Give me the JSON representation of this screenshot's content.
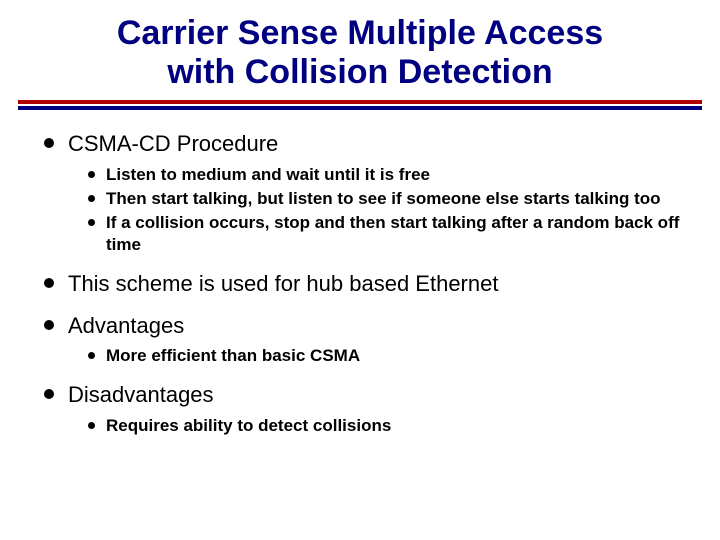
{
  "title_line1": "Carrier Sense Multiple Access",
  "title_line2": "with Collision Detection",
  "bullets": {
    "b1": {
      "text": "CSMA-CD Procedure",
      "sub": [
        "Listen to medium and wait until it is free",
        "Then start talking, but listen to see if someone else starts talking too",
        "If a collision occurs, stop and then start talking after a random back off time"
      ]
    },
    "b2": {
      "text": "This scheme is used for hub based Ethernet"
    },
    "b3": {
      "text": "Advantages",
      "sub": [
        "More efficient than basic CSMA"
      ]
    },
    "b4": {
      "text": "Disadvantages",
      "sub": [
        "Requires ability to detect collisions"
      ]
    }
  }
}
